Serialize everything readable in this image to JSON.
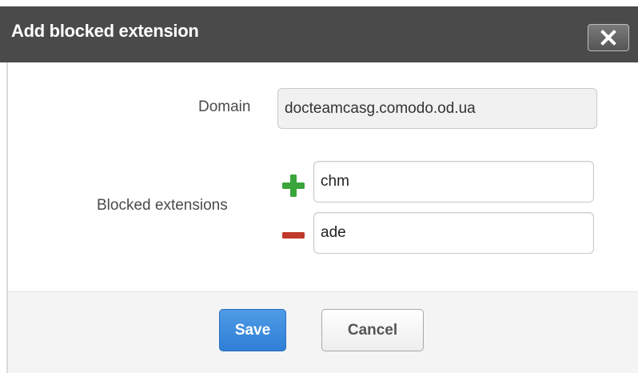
{
  "dialog": {
    "title": "Add blocked extension",
    "close_icon": "close-icon"
  },
  "form": {
    "domain_label": "Domain",
    "domain_value": "docteamcasg.comodo.od.ua",
    "blocked_label": "Blocked extensions",
    "extensions": [
      {
        "value": "chm",
        "icon": "plus-icon",
        "icon_color": "#3aa53a"
      },
      {
        "value": "ade",
        "icon": "minus-icon",
        "icon_color": "#c0392b"
      }
    ]
  },
  "footer": {
    "save_label": "Save",
    "cancel_label": "Cancel"
  },
  "colors": {
    "titlebar": "#4a4a4a",
    "save_button": "#3a8be0",
    "footer_bg": "#f4f4f4"
  }
}
